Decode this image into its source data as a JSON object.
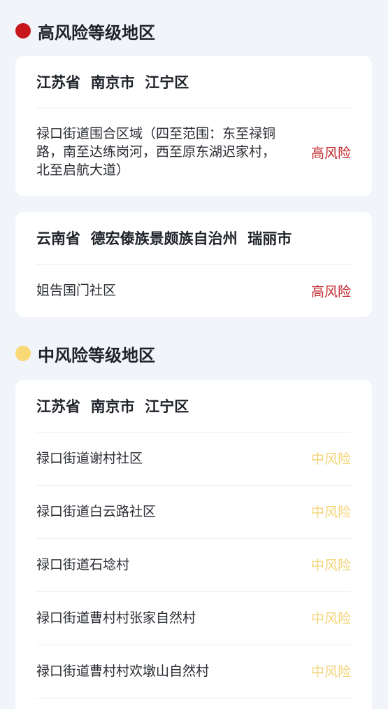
{
  "high": {
    "heading": "高风险等级地区",
    "dot_color": "#c8161d",
    "cards": [
      {
        "title": "江苏省  南京市  江宁区",
        "rows": [
          {
            "place": "禄口街道围合区域（四至范围：东至禄铜路，南至达练岗河，西至原东湖迟家村，北至启航大道）",
            "level": "高风险"
          }
        ]
      },
      {
        "title": "云南省  德宏傣族景颇族自治州  瑞丽市",
        "rows": [
          {
            "place": "姐告国门社区",
            "level": "高风险"
          }
        ]
      }
    ]
  },
  "mid": {
    "heading": "中风险等级地区",
    "dot_color": "#f9d976",
    "cards": [
      {
        "title": "江苏省  南京市  江宁区",
        "rows": [
          {
            "place": "禄口街道谢村社区",
            "level": "中风险"
          },
          {
            "place": "禄口街道白云路社区",
            "level": "中风险"
          },
          {
            "place": "禄口街道石埝村",
            "level": "中风险"
          },
          {
            "place": "禄口街道曹村村张家自然村",
            "level": "中风险"
          },
          {
            "place": "禄口街道曹村村欢墩山自然村",
            "level": "中风险"
          }
        ]
      }
    ]
  }
}
